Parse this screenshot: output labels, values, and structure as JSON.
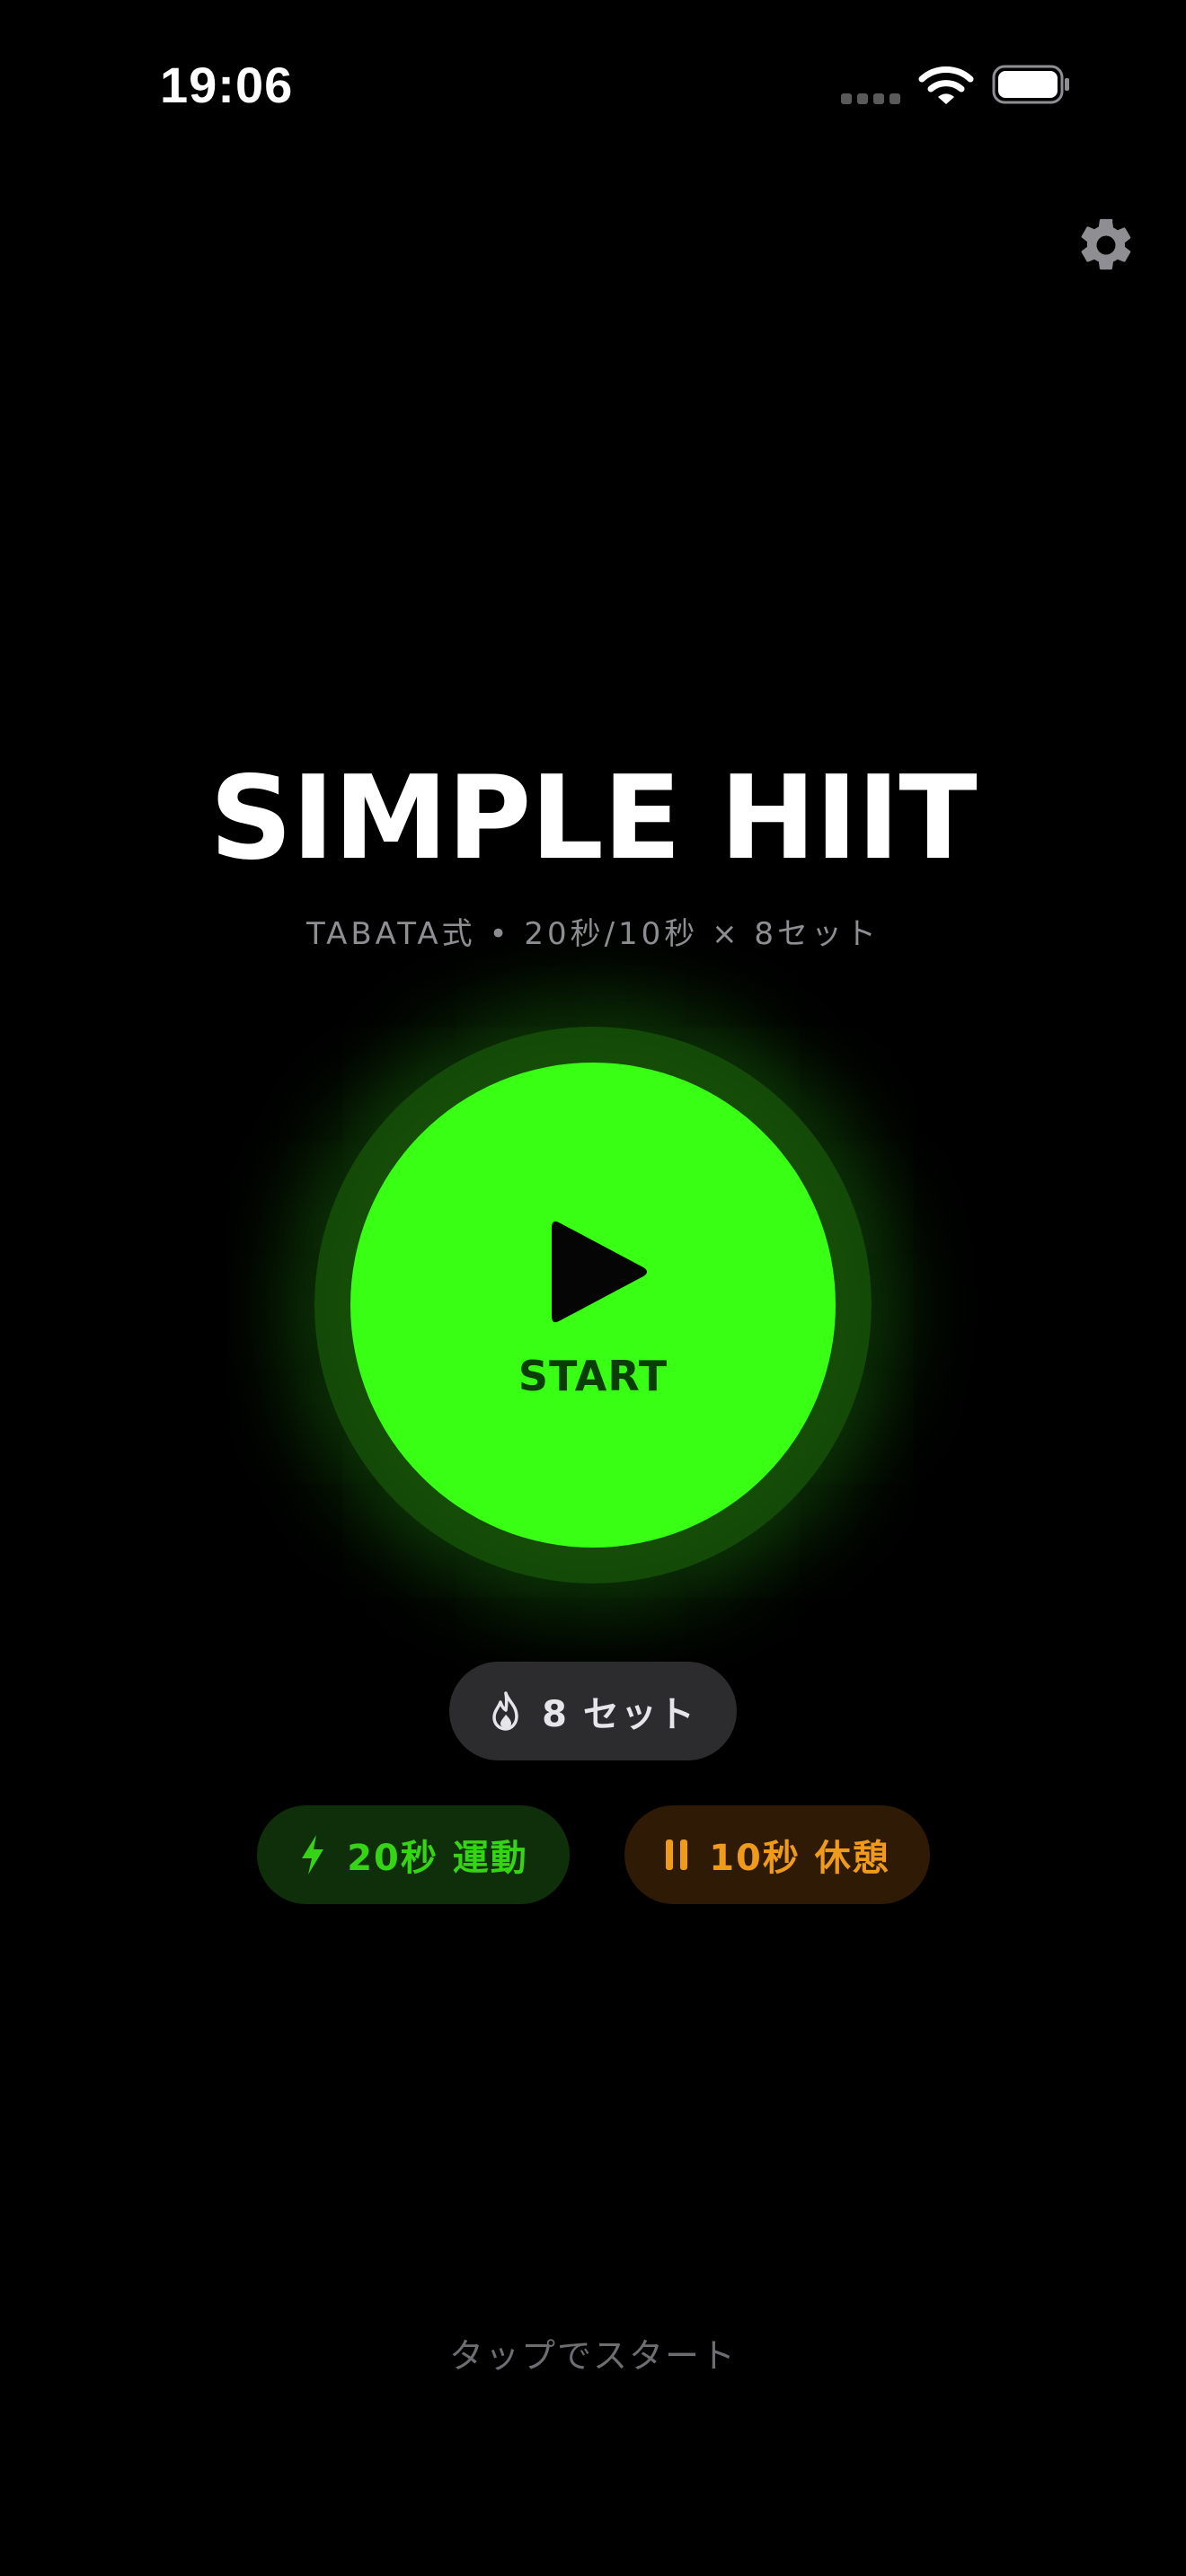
{
  "status_bar": {
    "time": "19:06"
  },
  "header": {
    "settings_icon": "gear-icon"
  },
  "main": {
    "title": "SIMPLE HIIT",
    "subtitle": "TABATA式 • 20秒/10秒 × 8セット",
    "start_button": {
      "label": "START",
      "icon": "play-icon",
      "color": "#39ff14"
    }
  },
  "pills": {
    "sets": {
      "label": "8 セット",
      "icon": "flame-icon"
    },
    "work": {
      "label": "20秒 運動",
      "icon": "bolt-icon",
      "color": "#35d414"
    },
    "rest": {
      "label": "10秒 休憩",
      "icon": "pause-icon",
      "color": "#f09a1a"
    }
  },
  "footer": {
    "hint": "タップでスタート"
  }
}
